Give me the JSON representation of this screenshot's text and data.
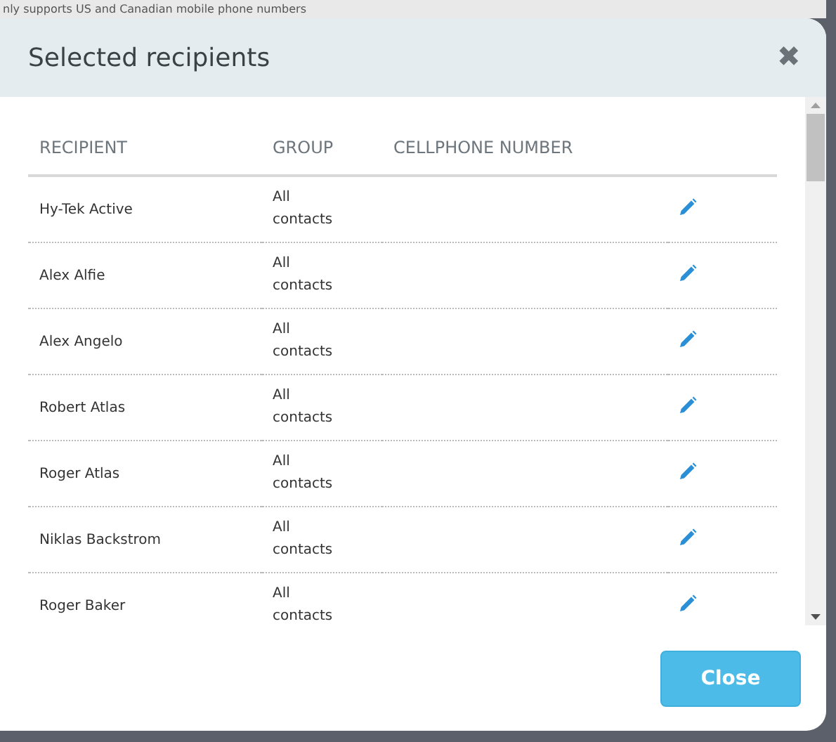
{
  "background_text": "nly supports US and Canadian mobile phone numbers",
  "dialog": {
    "title": "Selected recipients",
    "close_icon": "✖"
  },
  "table": {
    "columns": [
      "RECIPIENT",
      "GROUP",
      "CELLPHONE NUMBER"
    ],
    "rows": [
      {
        "recipient": "Hy-Tek Active",
        "group": "All contacts"
      },
      {
        "recipient": "Alex Alfie",
        "group": "All contacts"
      },
      {
        "recipient": "Alex Angelo",
        "group": "All contacts"
      },
      {
        "recipient": "Robert Atlas",
        "group": "All contacts"
      },
      {
        "recipient": "Roger Atlas",
        "group": "All contacts"
      },
      {
        "recipient": "Niklas Backstrom",
        "group": "All contacts"
      },
      {
        "recipient": "Roger Baker",
        "group": "All contacts"
      }
    ]
  },
  "buttons": [
    "Close"
  ]
}
